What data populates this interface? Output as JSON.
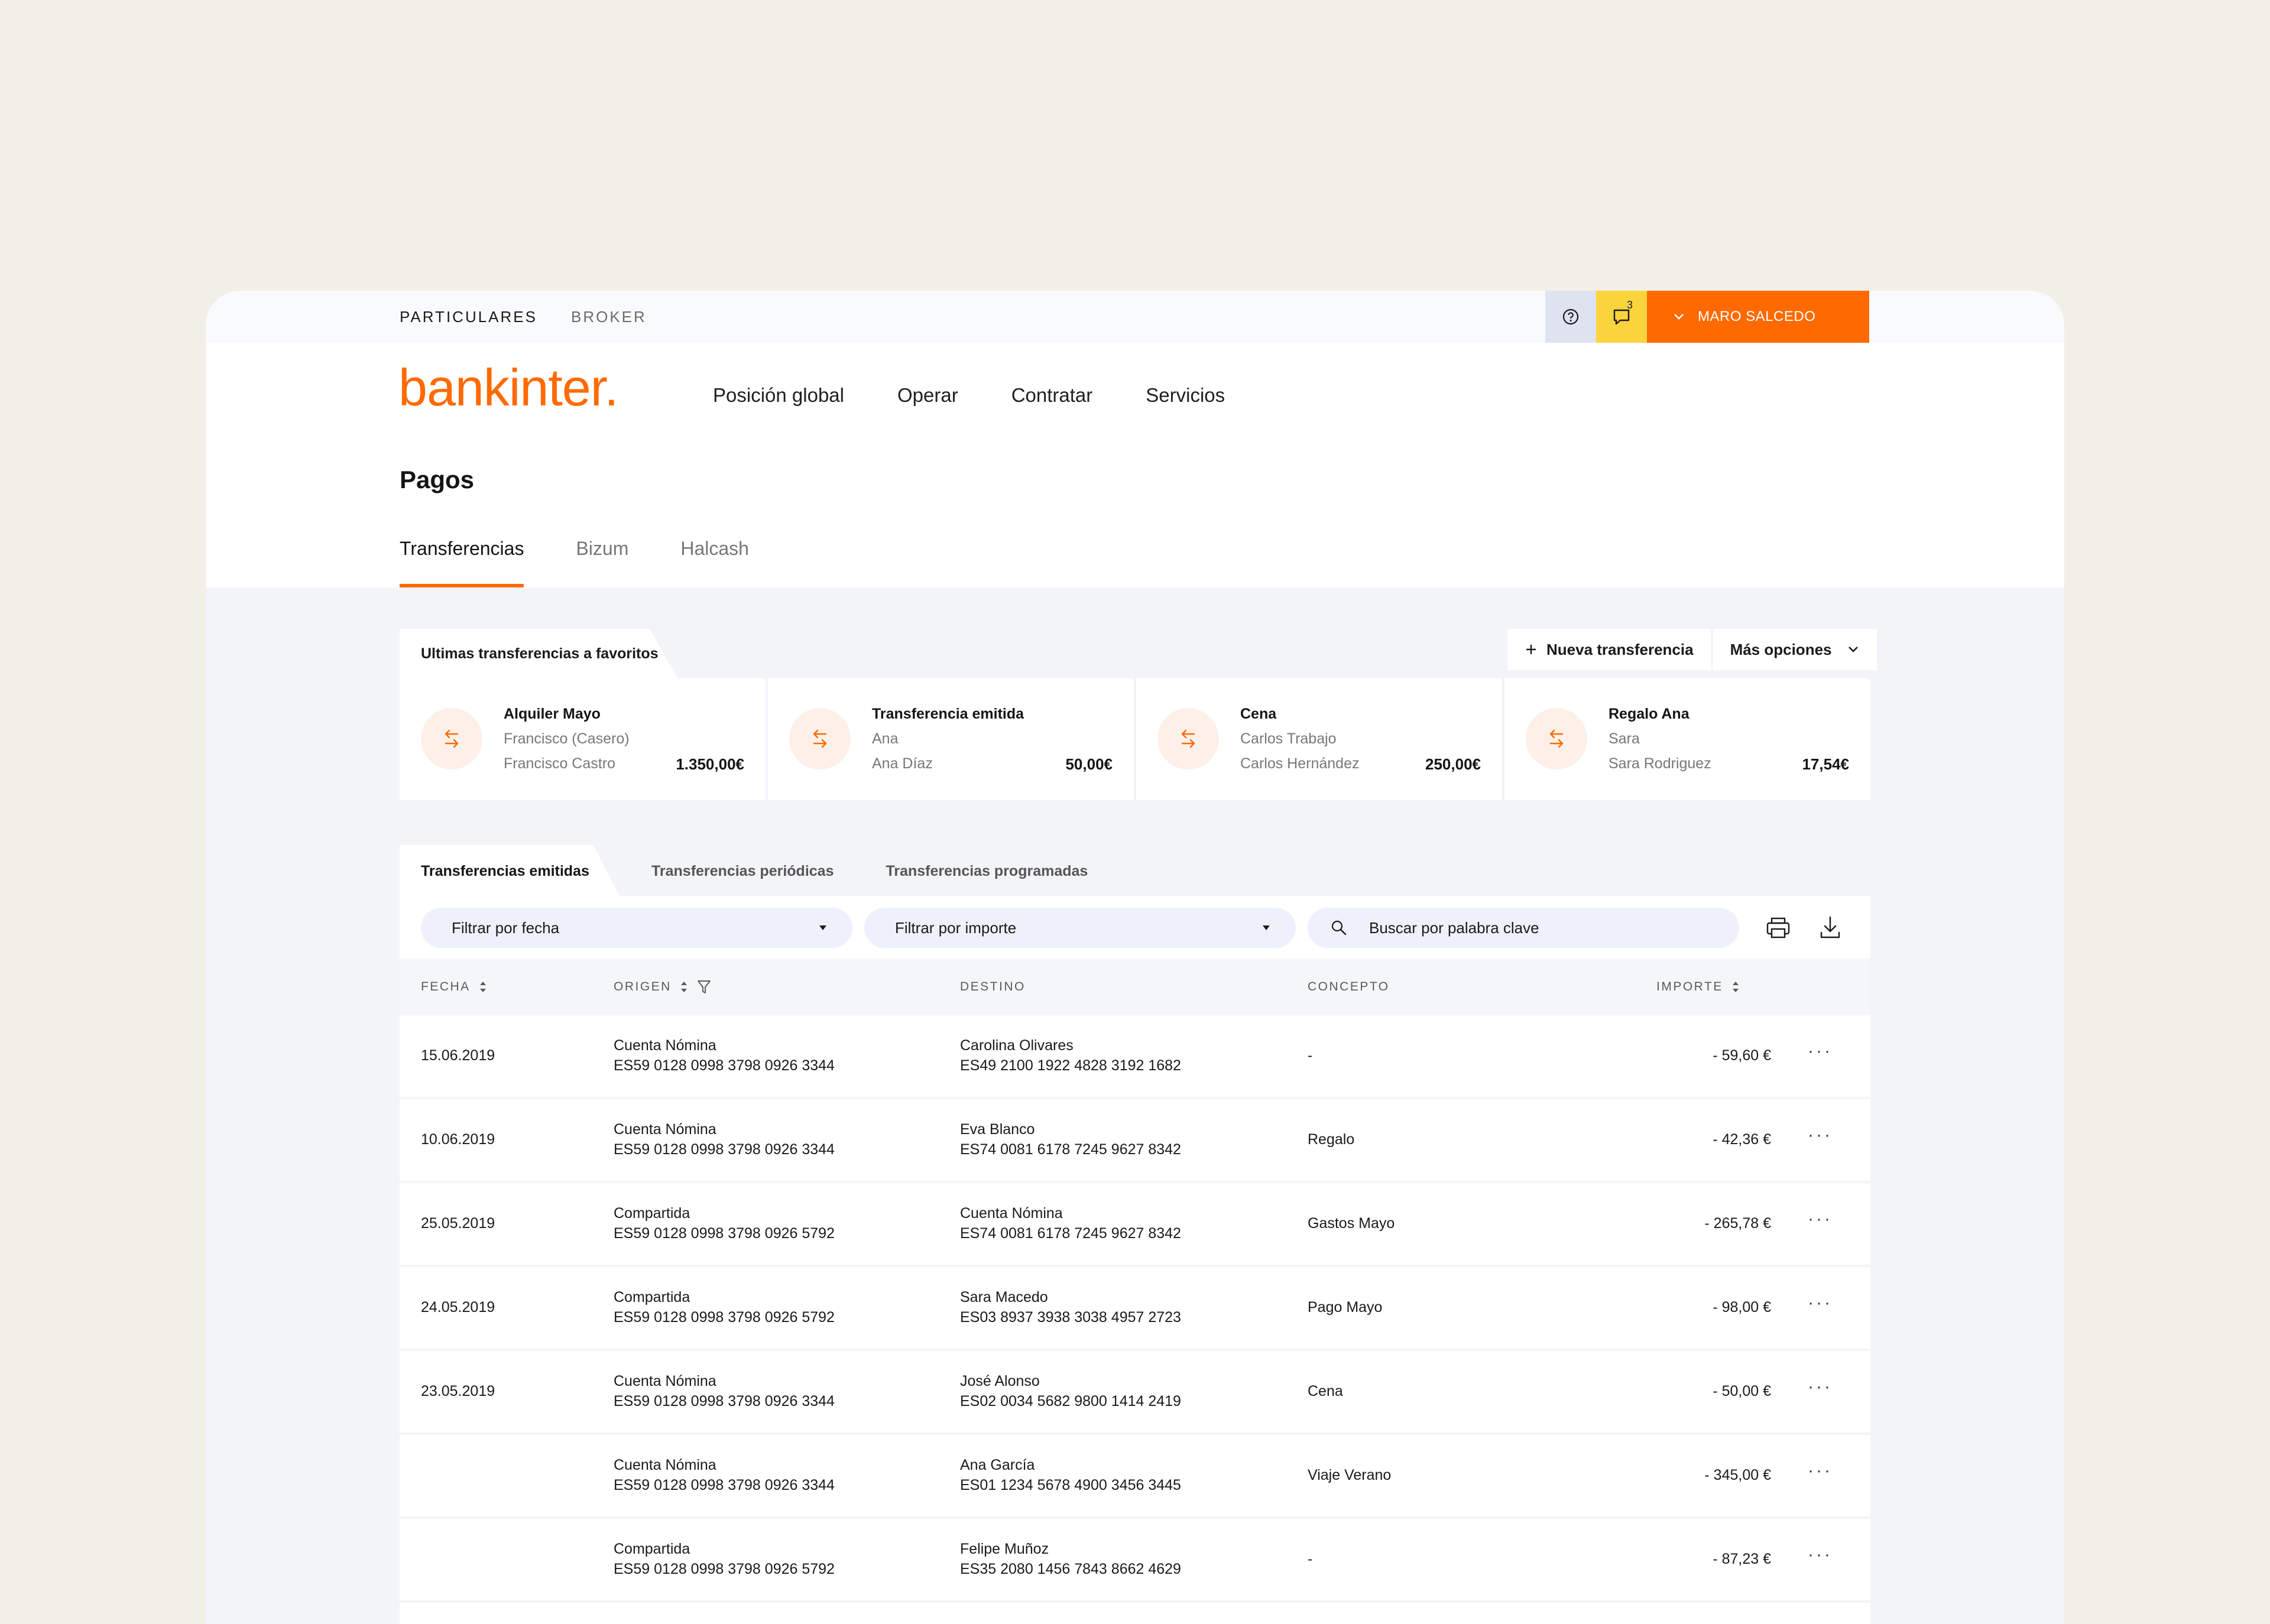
{
  "topbar": {
    "segment_personal": "PARTICULARES",
    "segment_broker": "BROKER",
    "help_icon": "question-circle-icon",
    "chat_icon": "chat-bubble-icon",
    "chat_badge": "3",
    "user_name": "MARO SALCEDO"
  },
  "header": {
    "logo_text": "bankinter.",
    "nav": [
      "Posición global",
      "Operar",
      "Contratar",
      "Servicios"
    ],
    "page_title": "Pagos",
    "tabs": [
      "Transferencias",
      "Bizum",
      "Halcash"
    ],
    "active_tab": "Transferencias"
  },
  "favorites": {
    "title": "Ultimas transferencias a favoritos",
    "new_transfer": "Nueva transferencia",
    "more_options": "Más opciones",
    "cards": [
      {
        "name": "Alquiler Mayo",
        "line2": "Francisco (Casero)",
        "line3": "Francisco Castro",
        "amount": "1.350,00€"
      },
      {
        "name": "Transferencia emitida",
        "line2": "Ana",
        "line3": "Ana Díaz",
        "amount": "50,00€"
      },
      {
        "name": "Cena",
        "line2": "Carlos Trabajo",
        "line3": "Carlos Hernández",
        "amount": "250,00€"
      },
      {
        "name": "Regalo Ana",
        "line2": "Sara",
        "line3": "Sara Rodriguez",
        "amount": "17,54€"
      }
    ]
  },
  "transfers": {
    "tabs": [
      "Transferencias emitidas",
      "Transferencias periódicas",
      "Transferencias programadas"
    ],
    "filter_date": "Filtrar por fecha",
    "filter_amount": "Filtrar por importe",
    "search_placeholder": "Buscar por palabra clave",
    "columns": [
      "FECHA",
      "ORIGEN",
      "DESTINO",
      "CONCEPTO",
      "IMPORTE"
    ],
    "rows": [
      {
        "fecha": "15.06.2019",
        "origen": "Cuenta Nómina",
        "origen_iban": "ES59 0128 0998 3798 0926 3344",
        "destino": "Carolina Olivares",
        "destino_iban": "ES49 2100 1922 4828 3192 1682",
        "concepto": "-",
        "importe": "- 59,60 €"
      },
      {
        "fecha": "10.06.2019",
        "origen": "Cuenta Nómina",
        "origen_iban": "ES59 0128 0998 3798 0926 3344",
        "destino": "Eva Blanco",
        "destino_iban": "ES74 0081 6178 7245 9627 8342",
        "concepto": "Regalo",
        "importe": "- 42,36 €"
      },
      {
        "fecha": "25.05.2019",
        "origen": "Compartida",
        "origen_iban": "ES59 0128 0998 3798 0926 5792",
        "destino": "Cuenta Nómina",
        "destino_iban": "ES74 0081 6178 7245 9627 8342",
        "concepto": "Gastos Mayo",
        "importe": "- 265,78 €"
      },
      {
        "fecha": "24.05.2019",
        "origen": "Compartida",
        "origen_iban": "ES59 0128 0998 3798 0926 5792",
        "destino": "Sara Macedo",
        "destino_iban": "ES03 8937 3938 3038 4957 2723",
        "concepto": "Pago Mayo",
        "importe": "- 98,00 €"
      },
      {
        "fecha": "23.05.2019",
        "origen": "Cuenta Nómina",
        "origen_iban": "ES59 0128 0998 3798 0926 3344",
        "destino": "José Alonso",
        "destino_iban": "ES02 0034 5682 9800 1414 2419",
        "concepto": "Cena",
        "importe": "- 50,00 €"
      },
      {
        "fecha": "",
        "origen": "Cuenta Nómina",
        "origen_iban": "ES59 0128 0998 3798 0926 3344",
        "destino": "Ana García",
        "destino_iban": "ES01 1234 5678 4900 3456 3445",
        "concepto": "Viaje Verano",
        "importe": "- 345,00 €"
      },
      {
        "fecha": "",
        "origen": "Compartida",
        "origen_iban": "ES59 0128 0998 3798 0926 5792",
        "destino": "Felipe Muñoz",
        "destino_iban": "ES35 2080 1456 7843 8662 4629",
        "concepto": "-",
        "importe": "- 87,23 €"
      }
    ],
    "row_menu": "···"
  },
  "colors": {
    "brand": "#ff6a00",
    "badge_yellow": "#fbd33d",
    "help_bg": "#dfe3f0"
  }
}
